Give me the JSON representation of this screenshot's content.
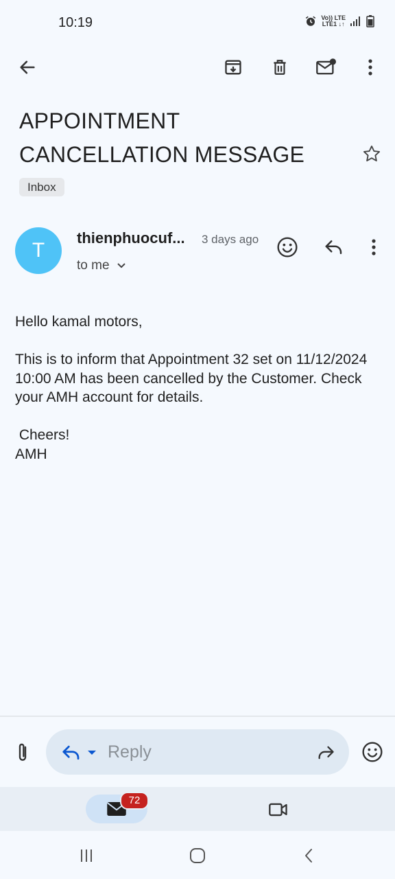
{
  "status_bar": {
    "time": "10:19",
    "network_top": "Vo)) LTE",
    "network_bottom": "LTE1 ↓↑"
  },
  "toolbar": {
    "back_icon": "arrow-left-icon",
    "archive_icon": "archive-icon",
    "delete_icon": "trash-icon",
    "mark_unread_icon": "mail-unread-icon",
    "more_icon": "more-vert-icon"
  },
  "email": {
    "subject": "APPOINTMENT CANCELLATION MESSAGE",
    "label": "Inbox",
    "sender_initial": "T",
    "sender": "thienphuocuf...",
    "time": "3 days ago",
    "recipient": "to me",
    "body": {
      "greeting": "Hello kamal motors,",
      "line1": "This is to inform that Appointment 32 set on 11/12/2024 10:00 AM has been cancelled by the Customer.  Check your AMH account for details.",
      "signoff": " Cheers!",
      "signature": "AMH"
    }
  },
  "reply_bar": {
    "placeholder": "Reply"
  },
  "bottom_nav": {
    "mail_badge": "72"
  },
  "colors": {
    "background": "#f5f9fe",
    "avatar": "#4fc3f7",
    "badge": "#c5221f",
    "reply_accent": "#0b57d0"
  }
}
